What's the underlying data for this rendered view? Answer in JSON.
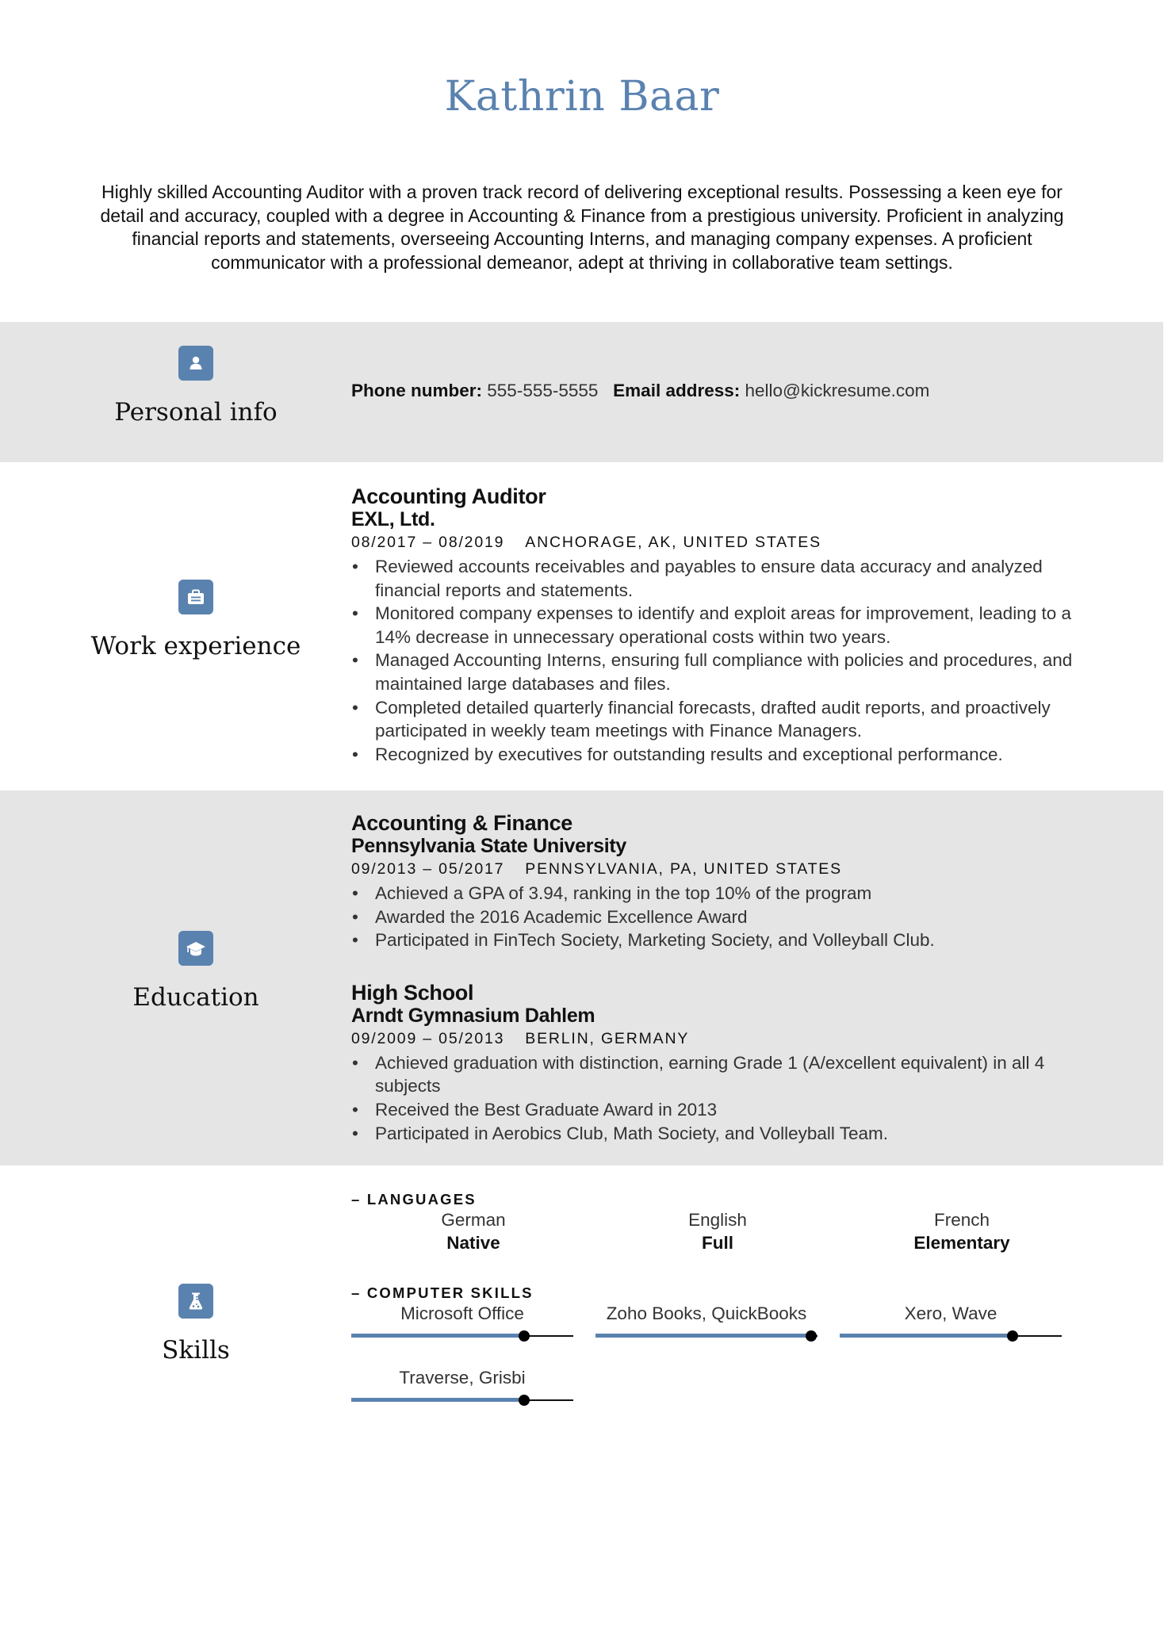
{
  "name": "Kathrin Baar",
  "summary": "Highly skilled Accounting Auditor with a proven track record of delivering exceptional results. Possessing a keen eye for detail and accuracy, coupled with a degree in Accounting & Finance from a prestigious university. Proficient in analyzing financial reports and statements, overseeing Accounting Interns, and managing company expenses. A proficient communicator with a professional demeanor, adept at thriving in collaborative team settings.",
  "accent_color": "#5a82af",
  "band_color": "#e5e5e5",
  "sections": {
    "personal": {
      "title": "Personal info",
      "icon": "user-icon",
      "phone_label": "Phone number:",
      "phone": "555-555-5555",
      "email_label": "Email address:",
      "email": "hello@kickresume.com"
    },
    "work": {
      "title": "Work experience",
      "icon": "briefcase-icon",
      "entries": [
        {
          "title": "Accounting Auditor",
          "org": "EXL, Ltd.",
          "dates": "08/2017 – 08/2019",
          "location": "ANCHORAGE, AK, UNITED STATES",
          "bullets": [
            "Reviewed accounts receivables and payables to ensure data accuracy and analyzed financial reports and statements.",
            "Monitored company expenses to identify and exploit areas for improvement, leading to a 14% decrease in unnecessary operational costs within two years.",
            "Managed Accounting Interns, ensuring full compliance with policies and procedures, and maintained large databases and files.",
            "Completed detailed quarterly financial forecasts, drafted audit reports, and proactively participated in weekly team meetings with Finance Managers.",
            "Recognized by executives for outstanding results and exceptional performance."
          ]
        }
      ]
    },
    "education": {
      "title": "Education",
      "icon": "graduation-cap-icon",
      "entries": [
        {
          "title": "Accounting & Finance",
          "org": "Pennsylvania State University",
          "dates": "09/2013 – 05/2017",
          "location": "PENNSYLVANIA, PA, UNITED STATES",
          "bullets": [
            "Achieved a GPA of 3.94, ranking in the top 10% of the program",
            "Awarded the 2016 Academic Excellence Award",
            "Participated in FinTech Society, Marketing Society, and Volleyball Club."
          ]
        },
        {
          "title": "High School",
          "org": "Arndt Gymnasium Dahlem",
          "dates": "09/2009 – 05/2013",
          "location": "BERLIN, GERMANY",
          "bullets": [
            "Achieved graduation with distinction, earning Grade 1 (A/excellent equivalent) in all 4 subjects",
            "Received the Best Graduate Award in 2013",
            "Participated in Aerobics Club, Math Society, and Volleyball Team."
          ]
        }
      ]
    },
    "skills": {
      "title": "Skills",
      "icon": "flask-icon",
      "languages_heading": "– LANGUAGES",
      "languages": [
        {
          "name": "German",
          "level": "Native"
        },
        {
          "name": "English",
          "level": "Full"
        },
        {
          "name": "French",
          "level": "Elementary"
        }
      ],
      "computer_heading": "– COMPUTER SKILLS",
      "computer": [
        {
          "name": "Microsoft Office",
          "level": 0.78
        },
        {
          "name": "Zoho Books, QuickBooks",
          "level": 1.0
        },
        {
          "name": "Xero, Wave",
          "level": 0.78
        },
        {
          "name": "Traverse, Grisbi",
          "level": 0.78
        }
      ]
    }
  }
}
